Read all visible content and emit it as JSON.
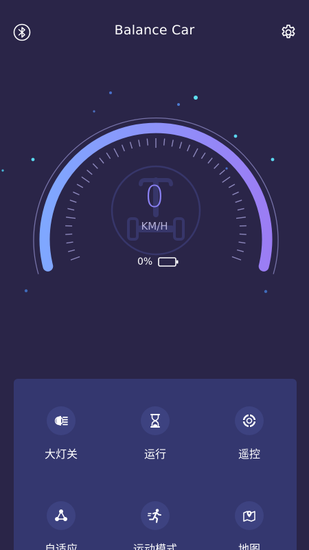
{
  "header": {
    "title": "Balance Car",
    "left_icon": "bluetooth-icon",
    "right_icon": "gear-icon"
  },
  "gauge": {
    "speed": "0",
    "unit": "KM/H",
    "battery_percent": "0%",
    "battery_level": 0,
    "accent_start": "#7fa0ff",
    "accent_end": "#9a7cf5"
  },
  "functions": [
    {
      "label": "大灯关",
      "icon": "headlight-icon"
    },
    {
      "label": "运行",
      "icon": "hourglass-icon"
    },
    {
      "label": "遥控",
      "icon": "remote-ring-icon"
    },
    {
      "label": "自适应",
      "icon": "adaptive-nodes-icon"
    },
    {
      "label": "运动模式",
      "icon": "running-man-icon"
    },
    {
      "label": "地图",
      "icon": "map-pin-icon"
    }
  ]
}
